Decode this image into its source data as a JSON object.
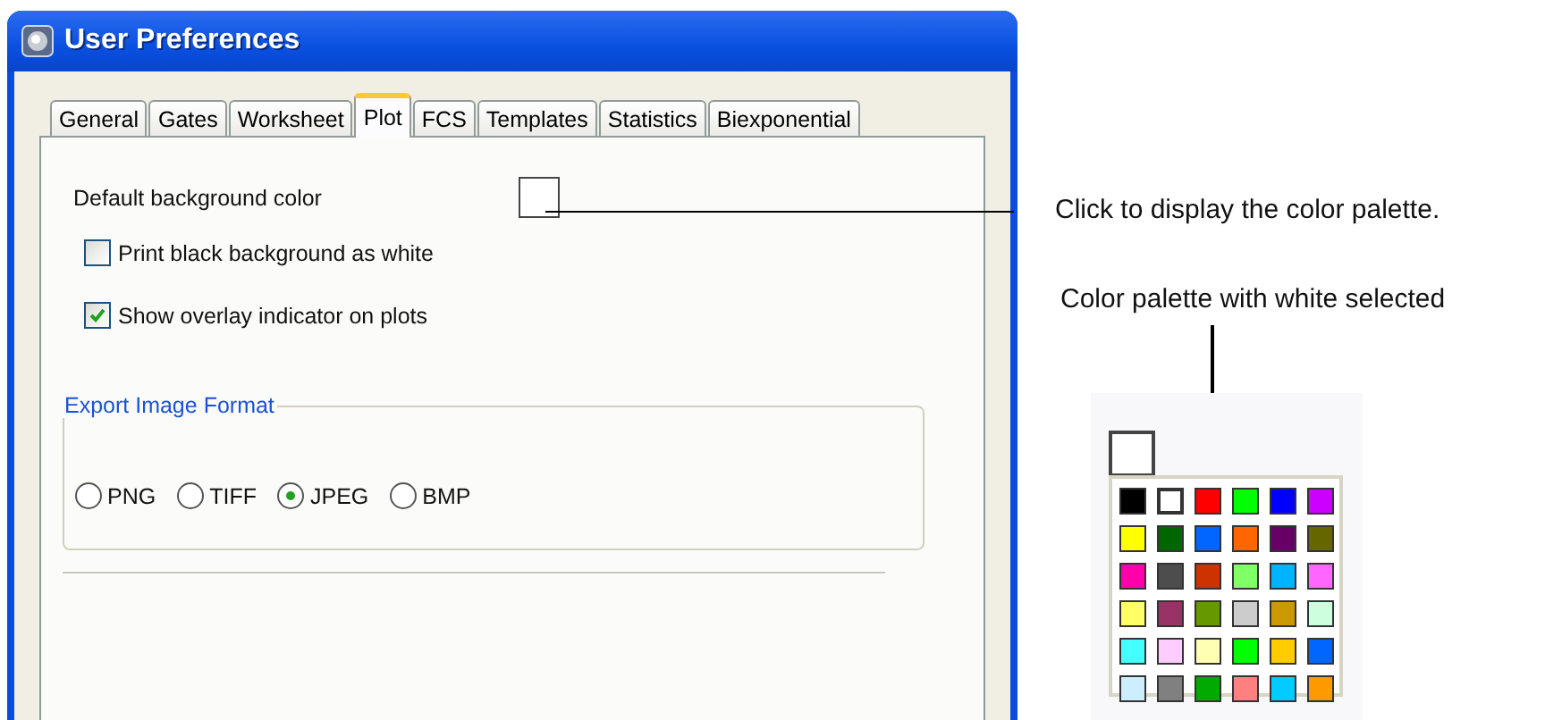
{
  "window": {
    "title": "User Preferences"
  },
  "tabs": [
    {
      "label": "General",
      "selected": false
    },
    {
      "label": "Gates",
      "selected": false
    },
    {
      "label": "Worksheet",
      "selected": false
    },
    {
      "label": "Plot",
      "selected": true
    },
    {
      "label": "FCS",
      "selected": false
    },
    {
      "label": "Templates",
      "selected": false
    },
    {
      "label": "Statistics",
      "selected": false
    },
    {
      "label": "Biexponential",
      "selected": false
    }
  ],
  "background_color": {
    "label": "Default background color",
    "color": "#ffffff"
  },
  "checkboxes": [
    {
      "label": "Print black background as white",
      "checked": false
    },
    {
      "label": "Show overlay indicator on plots",
      "checked": true
    }
  ],
  "export_image_format": {
    "title": "Export Image Format",
    "options": [
      {
        "label": "PNG",
        "selected": false
      },
      {
        "label": "TIFF",
        "selected": false
      },
      {
        "label": "JPEG",
        "selected": true
      },
      {
        "label": "BMP",
        "selected": false
      }
    ]
  },
  "callouts": [
    "Click to display the color palette.",
    "Color palette with white selected"
  ],
  "palette": {
    "color": "#ffffff",
    "cells": [
      {
        "color": "#000000",
        "selected": false
      },
      {
        "color": "#ffffff",
        "selected": true
      },
      {
        "color": "#ff0000",
        "selected": false
      },
      {
        "color": "#00ff00",
        "selected": false
      },
      {
        "color": "#0000ff",
        "selected": false
      },
      {
        "color": "#cc00ff",
        "selected": false
      },
      {
        "color": "#ffff00",
        "selected": false
      },
      {
        "color": "#006600",
        "selected": false
      },
      {
        "color": "#0066ff",
        "selected": false
      },
      {
        "color": "#ff6600",
        "selected": false
      },
      {
        "color": "#660066",
        "selected": false
      },
      {
        "color": "#666600",
        "selected": false
      },
      {
        "color": "#ff00aa",
        "selected": false
      },
      {
        "color": "#4d4d4d",
        "selected": false
      },
      {
        "color": "#cc3300",
        "selected": false
      },
      {
        "color": "#80ff66",
        "selected": false
      },
      {
        "color": "#00b3ff",
        "selected": false
      },
      {
        "color": "#ff66ff",
        "selected": false
      },
      {
        "color": "#ffff66",
        "selected": false
      },
      {
        "color": "#993366",
        "selected": false
      },
      {
        "color": "#669900",
        "selected": false
      },
      {
        "color": "#cccccc",
        "selected": false
      },
      {
        "color": "#cc9900",
        "selected": false
      },
      {
        "color": "#ccffdd",
        "selected": false
      },
      {
        "color": "#44ffff",
        "selected": false
      },
      {
        "color": "#ffccff",
        "selected": false
      },
      {
        "color": "#ffffb3",
        "selected": false
      },
      {
        "color": "#00ff00",
        "selected": false
      },
      {
        "color": "#ffcc00",
        "selected": false
      },
      {
        "color": "#0066ff",
        "selected": false
      },
      {
        "color": "#cceeff",
        "selected": false
      },
      {
        "color": "#808080",
        "selected": false
      },
      {
        "color": "#00aa00",
        "selected": false
      },
      {
        "color": "#ff8080",
        "selected": false
      },
      {
        "color": "#00ccff",
        "selected": false
      },
      {
        "color": "#ff9900",
        "selected": false
      }
    ]
  }
}
